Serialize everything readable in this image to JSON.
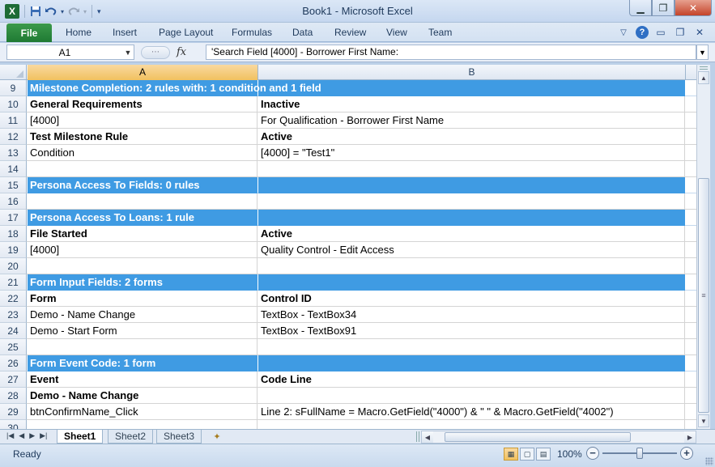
{
  "window": {
    "title": "Book1  -  Microsoft Excel",
    "icons": {
      "app": "excel-icon",
      "save": "save-icon",
      "undo": "undo-icon",
      "redo": "redo-icon",
      "customize": "customize-qat-icon"
    },
    "logo_letter": "X"
  },
  "ribbon": {
    "file_label": "File",
    "tabs": [
      "Home",
      "Insert",
      "Page Layout",
      "Formulas",
      "Data",
      "Review",
      "View",
      "Team"
    ],
    "help_label": "?"
  },
  "formula_bar": {
    "cell_ref": "A1",
    "fx_label": "fx",
    "value": "'Search Field [4000] - Borrower First Name:"
  },
  "columns": [
    "A",
    "B"
  ],
  "rows": [
    {
      "num": "9",
      "a": "Milestone Completion:  2 rules with:  1 condition and 1 field",
      "b": "",
      "style": "header"
    },
    {
      "num": "10",
      "a": "General Requirements",
      "b": "Inactive",
      "style": "bold"
    },
    {
      "num": "11",
      "a": "[4000]",
      "b": "For Qualification - Borrower First Name",
      "style": "normal"
    },
    {
      "num": "12",
      "a": "Test Milestone Rule",
      "b": "Active",
      "style": "bold"
    },
    {
      "num": "13",
      "a": "Condition",
      "b": "[4000] = \"Test1\"",
      "style": "normal"
    },
    {
      "num": "14",
      "a": "",
      "b": "",
      "style": "normal"
    },
    {
      "num": "15",
      "a": "Persona Access To Fields:  0 rules",
      "b": "",
      "style": "header"
    },
    {
      "num": "16",
      "a": "",
      "b": "",
      "style": "normal"
    },
    {
      "num": "17",
      "a": "Persona Access To Loans:  1 rule",
      "b": "",
      "style": "header"
    },
    {
      "num": "18",
      "a": "File Started",
      "b": "Active",
      "style": "bold"
    },
    {
      "num": "19",
      "a": "[4000]",
      "b": "Quality Control - Edit Access",
      "style": "normal"
    },
    {
      "num": "20",
      "a": "",
      "b": "",
      "style": "normal"
    },
    {
      "num": "21",
      "a": "Form Input Fields:  2 forms",
      "b": "",
      "style": "header"
    },
    {
      "num": "22",
      "a": "Form",
      "b": "Control ID",
      "style": "bold"
    },
    {
      "num": "23",
      "a": "Demo - Name Change",
      "b": "TextBox - TextBox34",
      "style": "normal"
    },
    {
      "num": "24",
      "a": "Demo - Start Form",
      "b": "TextBox - TextBox91",
      "style": "normal"
    },
    {
      "num": "25",
      "a": "",
      "b": "",
      "style": "normal"
    },
    {
      "num": "26",
      "a": "Form Event Code:  1 form",
      "b": "",
      "style": "header"
    },
    {
      "num": "27",
      "a": "Event",
      "b": "Code Line",
      "style": "bold"
    },
    {
      "num": "28",
      "a": "Demo - Name Change",
      "b": "",
      "style": "bold"
    },
    {
      "num": "29",
      "a": "btnConfirmName_Click",
      "b": "Line 2: sFullName = Macro.GetField(\"4000\") & \" \" & Macro.GetField(\"4002\")",
      "style": "normal"
    },
    {
      "num": "30",
      "a": "",
      "b": "",
      "style": "normal"
    }
  ],
  "sheets": [
    "Sheet1",
    "Sheet2",
    "Sheet3"
  ],
  "active_sheet": "Sheet1",
  "status": {
    "ready": "Ready",
    "zoom": "100%",
    "zoom_level": 100
  },
  "colors": {
    "section_header_bg": "#3f9be3",
    "file_tab": "#1f7a33",
    "selected_header": "#f1c15f"
  }
}
